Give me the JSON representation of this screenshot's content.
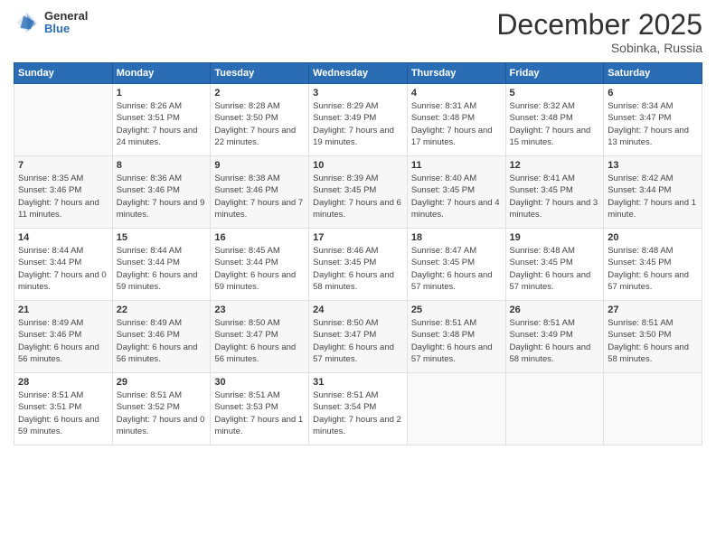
{
  "logo": {
    "general": "General",
    "blue": "Blue"
  },
  "header": {
    "month": "December 2025",
    "location": "Sobinka, Russia"
  },
  "days_of_week": [
    "Sunday",
    "Monday",
    "Tuesday",
    "Wednesday",
    "Thursday",
    "Friday",
    "Saturday"
  ],
  "weeks": [
    [
      {
        "day": "",
        "sunrise": "",
        "sunset": "",
        "daylight": ""
      },
      {
        "day": "1",
        "sunrise": "Sunrise: 8:26 AM",
        "sunset": "Sunset: 3:51 PM",
        "daylight": "Daylight: 7 hours and 24 minutes."
      },
      {
        "day": "2",
        "sunrise": "Sunrise: 8:28 AM",
        "sunset": "Sunset: 3:50 PM",
        "daylight": "Daylight: 7 hours and 22 minutes."
      },
      {
        "day": "3",
        "sunrise": "Sunrise: 8:29 AM",
        "sunset": "Sunset: 3:49 PM",
        "daylight": "Daylight: 7 hours and 19 minutes."
      },
      {
        "day": "4",
        "sunrise": "Sunrise: 8:31 AM",
        "sunset": "Sunset: 3:48 PM",
        "daylight": "Daylight: 7 hours and 17 minutes."
      },
      {
        "day": "5",
        "sunrise": "Sunrise: 8:32 AM",
        "sunset": "Sunset: 3:48 PM",
        "daylight": "Daylight: 7 hours and 15 minutes."
      },
      {
        "day": "6",
        "sunrise": "Sunrise: 8:34 AM",
        "sunset": "Sunset: 3:47 PM",
        "daylight": "Daylight: 7 hours and 13 minutes."
      }
    ],
    [
      {
        "day": "7",
        "sunrise": "Sunrise: 8:35 AM",
        "sunset": "Sunset: 3:46 PM",
        "daylight": "Daylight: 7 hours and 11 minutes."
      },
      {
        "day": "8",
        "sunrise": "Sunrise: 8:36 AM",
        "sunset": "Sunset: 3:46 PM",
        "daylight": "Daylight: 7 hours and 9 minutes."
      },
      {
        "day": "9",
        "sunrise": "Sunrise: 8:38 AM",
        "sunset": "Sunset: 3:46 PM",
        "daylight": "Daylight: 7 hours and 7 minutes."
      },
      {
        "day": "10",
        "sunrise": "Sunrise: 8:39 AM",
        "sunset": "Sunset: 3:45 PM",
        "daylight": "Daylight: 7 hours and 6 minutes."
      },
      {
        "day": "11",
        "sunrise": "Sunrise: 8:40 AM",
        "sunset": "Sunset: 3:45 PM",
        "daylight": "Daylight: 7 hours and 4 minutes."
      },
      {
        "day": "12",
        "sunrise": "Sunrise: 8:41 AM",
        "sunset": "Sunset: 3:45 PM",
        "daylight": "Daylight: 7 hours and 3 minutes."
      },
      {
        "day": "13",
        "sunrise": "Sunrise: 8:42 AM",
        "sunset": "Sunset: 3:44 PM",
        "daylight": "Daylight: 7 hours and 1 minute."
      }
    ],
    [
      {
        "day": "14",
        "sunrise": "Sunrise: 8:44 AM",
        "sunset": "Sunset: 3:44 PM",
        "daylight": "Daylight: 7 hours and 0 minutes."
      },
      {
        "day": "15",
        "sunrise": "Sunrise: 8:44 AM",
        "sunset": "Sunset: 3:44 PM",
        "daylight": "Daylight: 6 hours and 59 minutes."
      },
      {
        "day": "16",
        "sunrise": "Sunrise: 8:45 AM",
        "sunset": "Sunset: 3:44 PM",
        "daylight": "Daylight: 6 hours and 59 minutes."
      },
      {
        "day": "17",
        "sunrise": "Sunrise: 8:46 AM",
        "sunset": "Sunset: 3:45 PM",
        "daylight": "Daylight: 6 hours and 58 minutes."
      },
      {
        "day": "18",
        "sunrise": "Sunrise: 8:47 AM",
        "sunset": "Sunset: 3:45 PM",
        "daylight": "Daylight: 6 hours and 57 minutes."
      },
      {
        "day": "19",
        "sunrise": "Sunrise: 8:48 AM",
        "sunset": "Sunset: 3:45 PM",
        "daylight": "Daylight: 6 hours and 57 minutes."
      },
      {
        "day": "20",
        "sunrise": "Sunrise: 8:48 AM",
        "sunset": "Sunset: 3:45 PM",
        "daylight": "Daylight: 6 hours and 57 minutes."
      }
    ],
    [
      {
        "day": "21",
        "sunrise": "Sunrise: 8:49 AM",
        "sunset": "Sunset: 3:46 PM",
        "daylight": "Daylight: 6 hours and 56 minutes."
      },
      {
        "day": "22",
        "sunrise": "Sunrise: 8:49 AM",
        "sunset": "Sunset: 3:46 PM",
        "daylight": "Daylight: 6 hours and 56 minutes."
      },
      {
        "day": "23",
        "sunrise": "Sunrise: 8:50 AM",
        "sunset": "Sunset: 3:47 PM",
        "daylight": "Daylight: 6 hours and 56 minutes."
      },
      {
        "day": "24",
        "sunrise": "Sunrise: 8:50 AM",
        "sunset": "Sunset: 3:47 PM",
        "daylight": "Daylight: 6 hours and 57 minutes."
      },
      {
        "day": "25",
        "sunrise": "Sunrise: 8:51 AM",
        "sunset": "Sunset: 3:48 PM",
        "daylight": "Daylight: 6 hours and 57 minutes."
      },
      {
        "day": "26",
        "sunrise": "Sunrise: 8:51 AM",
        "sunset": "Sunset: 3:49 PM",
        "daylight": "Daylight: 6 hours and 58 minutes."
      },
      {
        "day": "27",
        "sunrise": "Sunrise: 8:51 AM",
        "sunset": "Sunset: 3:50 PM",
        "daylight": "Daylight: 6 hours and 58 minutes."
      }
    ],
    [
      {
        "day": "28",
        "sunrise": "Sunrise: 8:51 AM",
        "sunset": "Sunset: 3:51 PM",
        "daylight": "Daylight: 6 hours and 59 minutes."
      },
      {
        "day": "29",
        "sunrise": "Sunrise: 8:51 AM",
        "sunset": "Sunset: 3:52 PM",
        "daylight": "Daylight: 7 hours and 0 minutes."
      },
      {
        "day": "30",
        "sunrise": "Sunrise: 8:51 AM",
        "sunset": "Sunset: 3:53 PM",
        "daylight": "Daylight: 7 hours and 1 minute."
      },
      {
        "day": "31",
        "sunrise": "Sunrise: 8:51 AM",
        "sunset": "Sunset: 3:54 PM",
        "daylight": "Daylight: 7 hours and 2 minutes."
      },
      {
        "day": "",
        "sunrise": "",
        "sunset": "",
        "daylight": ""
      },
      {
        "day": "",
        "sunrise": "",
        "sunset": "",
        "daylight": ""
      },
      {
        "day": "",
        "sunrise": "",
        "sunset": "",
        "daylight": ""
      }
    ]
  ]
}
